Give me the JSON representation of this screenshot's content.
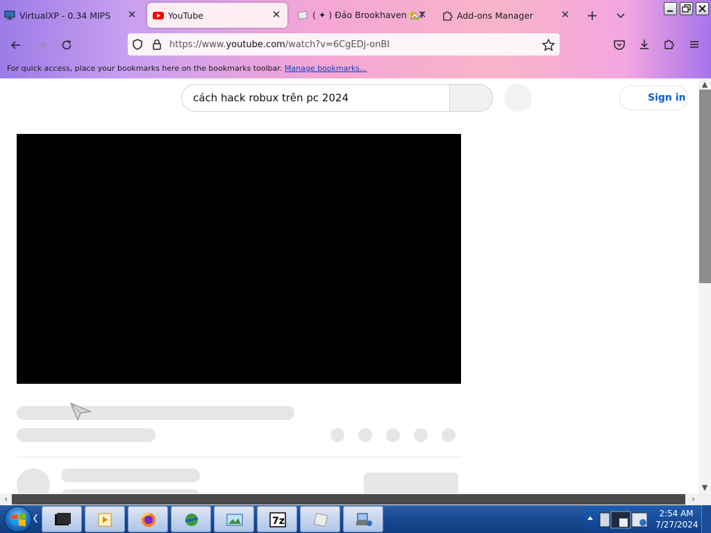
{
  "tabs": [
    {
      "title": "VirtualXP - 0.34 MIPS",
      "icon": "computer-icon",
      "active": false
    },
    {
      "title": "YouTube",
      "icon": "youtube-icon",
      "active": true
    },
    {
      "title": "( ✦ ) Đảo Brookhaven 🏡RP - Ro",
      "icon": "page-icon",
      "active": false
    },
    {
      "title": "Add-ons Manager",
      "icon": "puzzle-icon",
      "active": false
    }
  ],
  "tab_close_glyph": "✕",
  "new_tab_glyph": "+",
  "address": {
    "prefix": "https://www.",
    "domain": "youtube.com",
    "path": "/watch?v=6CgEDj-onBI"
  },
  "bookmarks_bar": {
    "message": "For quick access, place your bookmarks here on the bookmarks toolbar.",
    "link": "Manage bookmarks..."
  },
  "youtube": {
    "search_value": "cách hack robux trên pc 2024",
    "sign_in": "Sign in"
  },
  "taskbar": {
    "time": "2:54 AM",
    "date": "7/27/2024",
    "pinned": [
      "terminal-icon",
      "media-player-icon",
      "firefox-icon",
      "download-manager-icon",
      "image-viewer-icon",
      "7zip-icon",
      "roblox-icon",
      "network-icon"
    ]
  },
  "colors": {
    "accent_link": "#065fd4",
    "taskbar": "#184a93"
  }
}
